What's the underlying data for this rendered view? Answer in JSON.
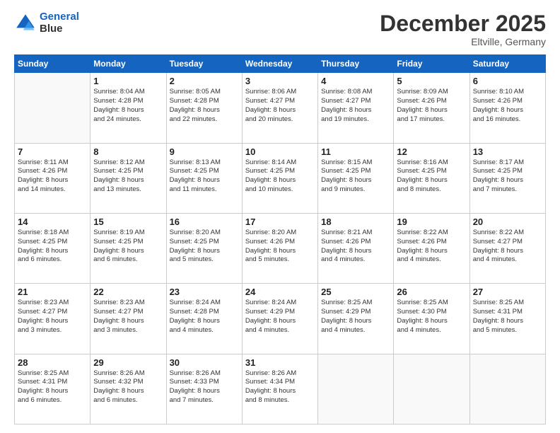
{
  "header": {
    "logo_line1": "General",
    "logo_line2": "Blue",
    "month": "December 2025",
    "location": "Eltville, Germany"
  },
  "weekdays": [
    "Sunday",
    "Monday",
    "Tuesday",
    "Wednesday",
    "Thursday",
    "Friday",
    "Saturday"
  ],
  "weeks": [
    [
      {
        "day": null,
        "info": null
      },
      {
        "day": "1",
        "info": "Sunrise: 8:04 AM\nSunset: 4:28 PM\nDaylight: 8 hours\nand 24 minutes."
      },
      {
        "day": "2",
        "info": "Sunrise: 8:05 AM\nSunset: 4:28 PM\nDaylight: 8 hours\nand 22 minutes."
      },
      {
        "day": "3",
        "info": "Sunrise: 8:06 AM\nSunset: 4:27 PM\nDaylight: 8 hours\nand 20 minutes."
      },
      {
        "day": "4",
        "info": "Sunrise: 8:08 AM\nSunset: 4:27 PM\nDaylight: 8 hours\nand 19 minutes."
      },
      {
        "day": "5",
        "info": "Sunrise: 8:09 AM\nSunset: 4:26 PM\nDaylight: 8 hours\nand 17 minutes."
      },
      {
        "day": "6",
        "info": "Sunrise: 8:10 AM\nSunset: 4:26 PM\nDaylight: 8 hours\nand 16 minutes."
      }
    ],
    [
      {
        "day": "7",
        "info": "Sunrise: 8:11 AM\nSunset: 4:26 PM\nDaylight: 8 hours\nand 14 minutes."
      },
      {
        "day": "8",
        "info": "Sunrise: 8:12 AM\nSunset: 4:25 PM\nDaylight: 8 hours\nand 13 minutes."
      },
      {
        "day": "9",
        "info": "Sunrise: 8:13 AM\nSunset: 4:25 PM\nDaylight: 8 hours\nand 11 minutes."
      },
      {
        "day": "10",
        "info": "Sunrise: 8:14 AM\nSunset: 4:25 PM\nDaylight: 8 hours\nand 10 minutes."
      },
      {
        "day": "11",
        "info": "Sunrise: 8:15 AM\nSunset: 4:25 PM\nDaylight: 8 hours\nand 9 minutes."
      },
      {
        "day": "12",
        "info": "Sunrise: 8:16 AM\nSunset: 4:25 PM\nDaylight: 8 hours\nand 8 minutes."
      },
      {
        "day": "13",
        "info": "Sunrise: 8:17 AM\nSunset: 4:25 PM\nDaylight: 8 hours\nand 7 minutes."
      }
    ],
    [
      {
        "day": "14",
        "info": "Sunrise: 8:18 AM\nSunset: 4:25 PM\nDaylight: 8 hours\nand 6 minutes."
      },
      {
        "day": "15",
        "info": "Sunrise: 8:19 AM\nSunset: 4:25 PM\nDaylight: 8 hours\nand 6 minutes."
      },
      {
        "day": "16",
        "info": "Sunrise: 8:20 AM\nSunset: 4:25 PM\nDaylight: 8 hours\nand 5 minutes."
      },
      {
        "day": "17",
        "info": "Sunrise: 8:20 AM\nSunset: 4:26 PM\nDaylight: 8 hours\nand 5 minutes."
      },
      {
        "day": "18",
        "info": "Sunrise: 8:21 AM\nSunset: 4:26 PM\nDaylight: 8 hours\nand 4 minutes."
      },
      {
        "day": "19",
        "info": "Sunrise: 8:22 AM\nSunset: 4:26 PM\nDaylight: 8 hours\nand 4 minutes."
      },
      {
        "day": "20",
        "info": "Sunrise: 8:22 AM\nSunset: 4:27 PM\nDaylight: 8 hours\nand 4 minutes."
      }
    ],
    [
      {
        "day": "21",
        "info": "Sunrise: 8:23 AM\nSunset: 4:27 PM\nDaylight: 8 hours\nand 3 minutes."
      },
      {
        "day": "22",
        "info": "Sunrise: 8:23 AM\nSunset: 4:27 PM\nDaylight: 8 hours\nand 3 minutes."
      },
      {
        "day": "23",
        "info": "Sunrise: 8:24 AM\nSunset: 4:28 PM\nDaylight: 8 hours\nand 4 minutes."
      },
      {
        "day": "24",
        "info": "Sunrise: 8:24 AM\nSunset: 4:29 PM\nDaylight: 8 hours\nand 4 minutes."
      },
      {
        "day": "25",
        "info": "Sunrise: 8:25 AM\nSunset: 4:29 PM\nDaylight: 8 hours\nand 4 minutes."
      },
      {
        "day": "26",
        "info": "Sunrise: 8:25 AM\nSunset: 4:30 PM\nDaylight: 8 hours\nand 4 minutes."
      },
      {
        "day": "27",
        "info": "Sunrise: 8:25 AM\nSunset: 4:31 PM\nDaylight: 8 hours\nand 5 minutes."
      }
    ],
    [
      {
        "day": "28",
        "info": "Sunrise: 8:25 AM\nSunset: 4:31 PM\nDaylight: 8 hours\nand 6 minutes."
      },
      {
        "day": "29",
        "info": "Sunrise: 8:26 AM\nSunset: 4:32 PM\nDaylight: 8 hours\nand 6 minutes."
      },
      {
        "day": "30",
        "info": "Sunrise: 8:26 AM\nSunset: 4:33 PM\nDaylight: 8 hours\nand 7 minutes."
      },
      {
        "day": "31",
        "info": "Sunrise: 8:26 AM\nSunset: 4:34 PM\nDaylight: 8 hours\nand 8 minutes."
      },
      {
        "day": null,
        "info": null
      },
      {
        "day": null,
        "info": null
      },
      {
        "day": null,
        "info": null
      }
    ]
  ]
}
